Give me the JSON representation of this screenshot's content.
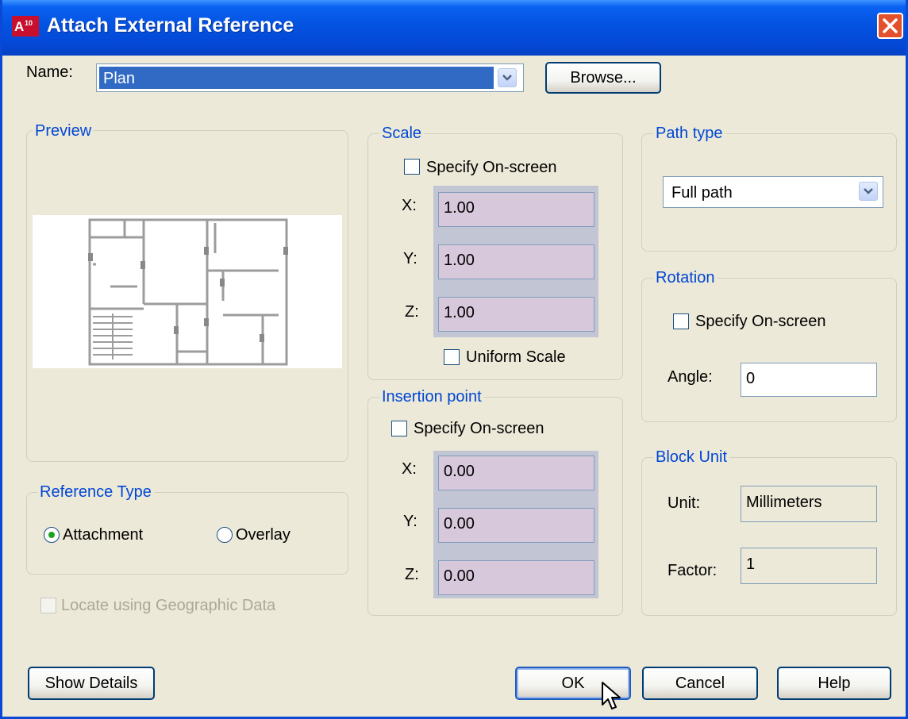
{
  "window": {
    "title": "Attach External Reference",
    "app_icon_text": "A10"
  },
  "name_row": {
    "label": "Name:",
    "value": "Plan",
    "browse_label": "Browse..."
  },
  "preview": {
    "title": "Preview"
  },
  "reference_type": {
    "title": "Reference Type",
    "options": [
      {
        "label": "Attachment",
        "selected": true
      },
      {
        "label": "Overlay",
        "selected": false
      }
    ]
  },
  "geo": {
    "label": "Locate using Geographic Data",
    "checked": false,
    "disabled": true
  },
  "scale": {
    "title": "Scale",
    "specify_label": "Specify On-screen",
    "x_label": "X:",
    "x": "1.00",
    "y_label": "Y:",
    "y": "1.00",
    "z_label": "Z:",
    "z": "1.00",
    "uniform_label": "Uniform Scale"
  },
  "insertion": {
    "title": "Insertion point",
    "specify_label": "Specify On-screen",
    "x_label": "X:",
    "x": "0.00",
    "y_label": "Y:",
    "y": "0.00",
    "z_label": "Z:",
    "z": "0.00"
  },
  "path_type": {
    "title": "Path type",
    "value": "Full path"
  },
  "rotation": {
    "title": "Rotation",
    "specify_label": "Specify On-screen",
    "angle_label": "Angle:",
    "angle": "0"
  },
  "block_unit": {
    "title": "Block Unit",
    "unit_label": "Unit:",
    "unit": "Millimeters",
    "factor_label": "Factor:",
    "factor": "1"
  },
  "buttons": {
    "show_details": "Show Details",
    "ok": "OK",
    "cancel": "Cancel",
    "help": "Help"
  },
  "colors": {
    "title_bar": "#0452e0",
    "group_title": "#0046d5",
    "dialog_bg": "#ece9d8",
    "selection": "#316ac5"
  }
}
